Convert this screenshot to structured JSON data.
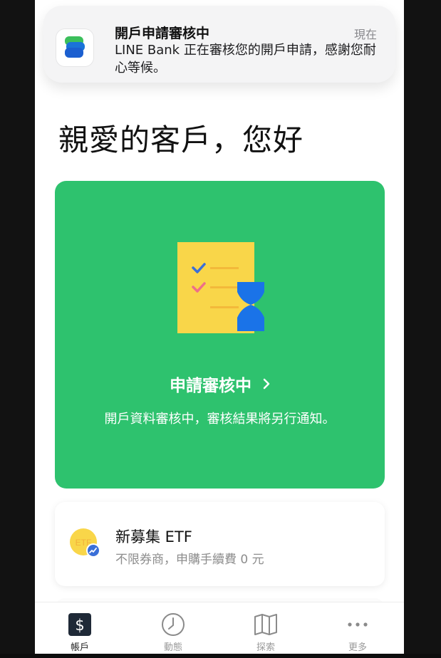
{
  "notification": {
    "title": "開戶申請審核中",
    "time": "現在",
    "body": "LINE Bank 正在審核您的開戶申請，感謝您耐心等候。",
    "app_icon": "line-bank-logo-icon"
  },
  "greeting": "親愛的客戶，您好",
  "status_card": {
    "title": "申請審核中",
    "description": "開戶資料審核中，審核結果將另行通知。",
    "accent_color": "#2ec26e",
    "illustration": "checklist-hourglass-icon"
  },
  "etf_card": {
    "icon_text": "ETF",
    "title": "新募集 ETF",
    "subtitle": "不限券商，申購手續費 0 元"
  },
  "tabbar": {
    "items": [
      {
        "label": "帳戶",
        "icon": "dollar-icon",
        "active": true
      },
      {
        "label": "動態",
        "icon": "clock-icon",
        "active": false
      },
      {
        "label": "探索",
        "icon": "map-icon",
        "active": false
      },
      {
        "label": "更多",
        "icon": "more-dots-icon",
        "active": false
      }
    ]
  }
}
